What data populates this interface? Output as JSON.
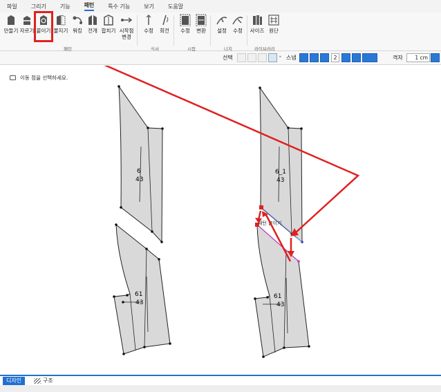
{
  "menu": {
    "tabs": [
      {
        "label": "파일"
      },
      {
        "label": "그리기"
      },
      {
        "label": "기능"
      },
      {
        "label": "패턴",
        "active": true
      },
      {
        "label": "특수 기능"
      },
      {
        "label": "보기"
      },
      {
        "label": "도움말"
      }
    ]
  },
  "ribbon": {
    "tools": [
      {
        "label": "만들기"
      },
      {
        "label": "자르기"
      },
      {
        "label": "붙이기"
      },
      {
        "label": "물지기"
      },
      {
        "label": "워킹"
      },
      {
        "label": "전개"
      },
      {
        "label": "합치기"
      },
      {
        "label": "시작점"
      },
      {
        "label": "수정"
      },
      {
        "label": "회전"
      },
      {
        "label": "수정"
      },
      {
        "label": "변환"
      },
      {
        "label": "설정"
      },
      {
        "label": "수정"
      },
      {
        "label": "사이즈"
      },
      {
        "label": "원단"
      }
    ],
    "tool_sub": {
      "label": "변경"
    },
    "groups": {
      "pattern": "패턴",
      "notch_axis": "식서",
      "seam": "시접",
      "notch": "너치",
      "library": "라이브러리"
    }
  },
  "options": {
    "select_label": "선택",
    "snap_label": "스냅",
    "snap_value": "2",
    "grid_label": "격자",
    "grid_value": "1 cm"
  },
  "canvas": {
    "hint": "이동 점을 선택하세요.",
    "pieces": {
      "left_top": {
        "name": "6",
        "size": "43"
      },
      "left_bottom": {
        "name": "61",
        "size": "43"
      },
      "right_top": {
        "name": "6_1",
        "size": "43"
      },
      "right_bottom": {
        "name": "61",
        "size": "43"
      }
    },
    "tooltip": "패턴 붙이기"
  },
  "bottom": {
    "tab_design": "디자인",
    "tab_structure": "구조"
  },
  "colors": {
    "accent": "#1f6fd0",
    "annotation_red": "#e02020",
    "piece_fill": "#d9d9d9",
    "magenta": "#cc33cc"
  }
}
